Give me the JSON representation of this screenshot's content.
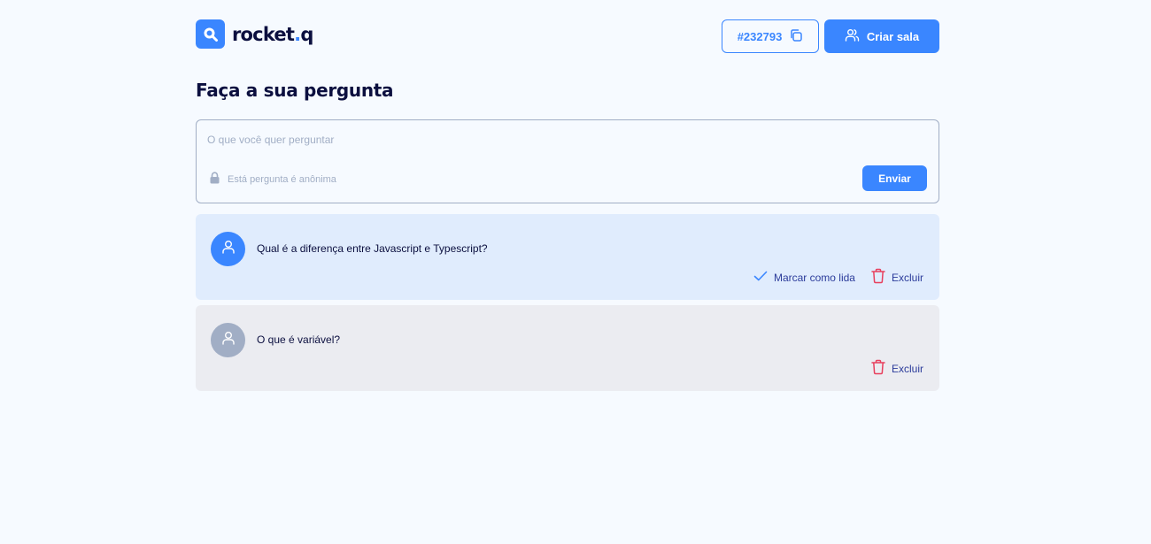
{
  "header": {
    "logo_text": "rocket",
    "logo_dot": ".",
    "logo_suffix": "q",
    "room_code": "#232793",
    "create_room_label": "Criar sala"
  },
  "page_title": "Faça a sua pergunta",
  "form": {
    "placeholder": "O que você quer perguntar",
    "value": "",
    "anonymous_label": "Está pergunta é anônima",
    "send_label": "Enviar"
  },
  "questions": [
    {
      "text": "Qual é a diferença entre Javascript e Typescript?",
      "read": false,
      "mark_read_label": "Marcar como lida",
      "delete_label": "Excluir"
    },
    {
      "text": "O que é variável?",
      "read": true,
      "delete_label": "Excluir"
    }
  ],
  "colors": {
    "accent": "#3a86ff",
    "background": "#f6faff",
    "text_dark": "#0b0f3f",
    "muted": "#a1aec5",
    "danger": "#e73f5d",
    "unread_card": "#e0ecfd",
    "read_card": "#ebecf1",
    "action_text": "#2c3c9b"
  },
  "icons": {
    "logo": "search-icon",
    "room_code": "copy-icon",
    "create_room": "users-icon",
    "anonymous": "lock-icon",
    "avatar": "user-icon",
    "mark_read": "check-icon",
    "delete": "trash-icon"
  }
}
